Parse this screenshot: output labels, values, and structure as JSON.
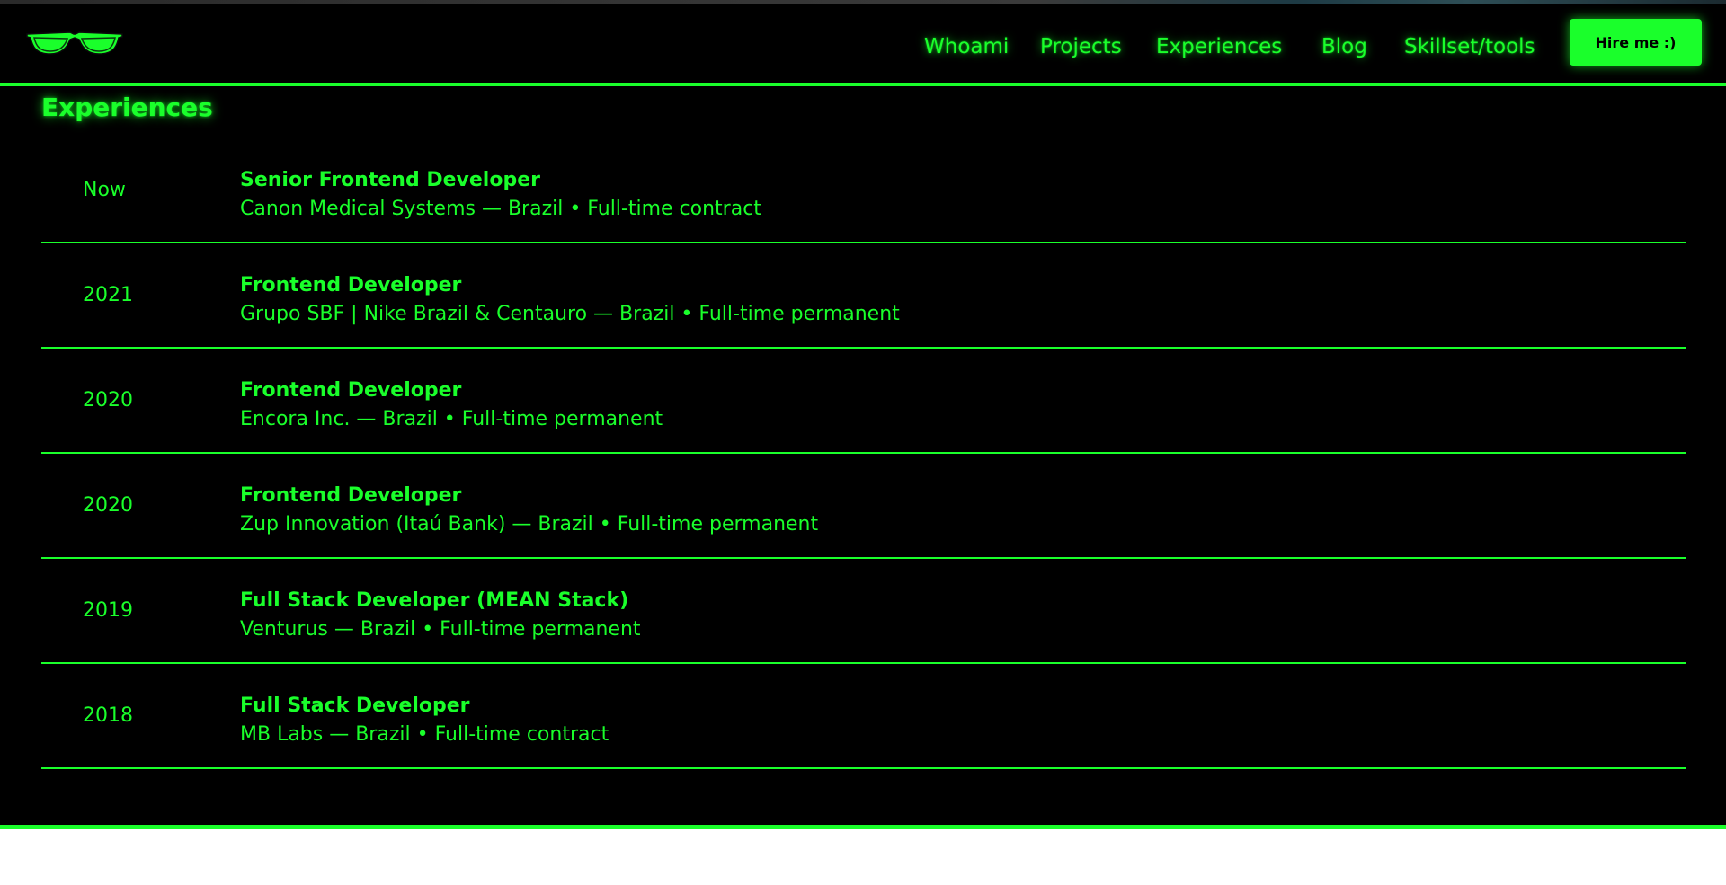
{
  "nav": {
    "items": [
      {
        "label": "Whoami"
      },
      {
        "label": "Projects"
      },
      {
        "label": "Experiences"
      },
      {
        "label": "Blog"
      },
      {
        "label": "Skillset/tools"
      }
    ],
    "hire_label": "Hire me :)"
  },
  "logo": {
    "icon": "sunglasses-icon"
  },
  "section": {
    "title": "Experiences"
  },
  "experiences": [
    {
      "year": "Now",
      "role": "Senior Frontend Developer",
      "company": "Canon Medical Systems — Brazil • Full-time contract"
    },
    {
      "year": "2021",
      "role": "Frontend Developer",
      "company": "Grupo SBF | Nike Brazil & Centauro — Brazil • Full-time permanent"
    },
    {
      "year": "2020",
      "role": "Frontend Developer",
      "company": "Encora Inc. — Brazil • Full-time permanent"
    },
    {
      "year": "2020",
      "role": "Frontend Developer",
      "company": "Zup Innovation (Itaú Bank) — Brazil • Full-time permanent"
    },
    {
      "year": "2019",
      "role": "Full Stack Developer (MEAN Stack)",
      "company": "Venturus — Brazil • Full-time permanent"
    },
    {
      "year": "2018",
      "role": "Full Stack Developer",
      "company": "MB Labs — Brazil • Full-time contract"
    }
  ],
  "colors": {
    "accent": "#1aff2b",
    "background": "#000000",
    "below_page": "#ffffff"
  }
}
